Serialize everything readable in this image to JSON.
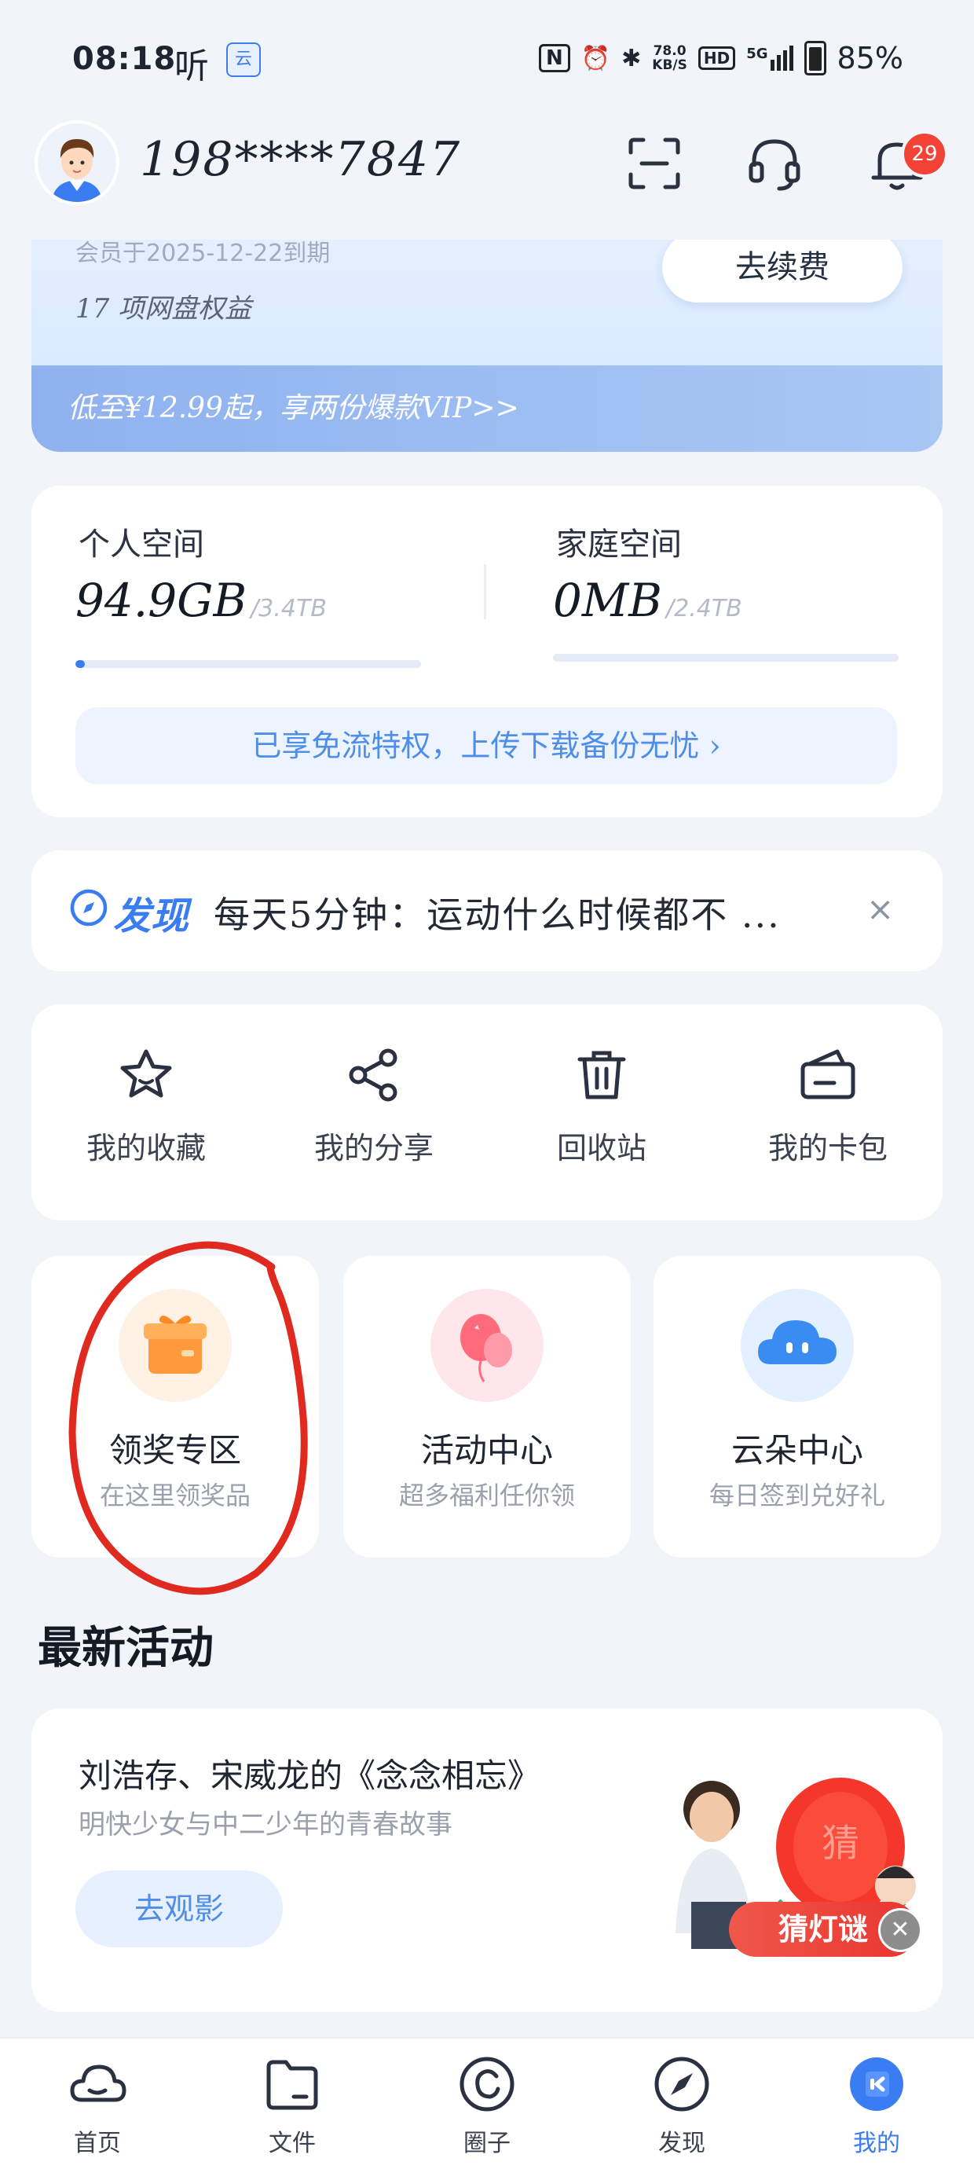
{
  "status_bar": {
    "time": "08:18",
    "ting": "听",
    "app_icon_text": "云",
    "nfc": "N",
    "net_speed_value": "78.0",
    "net_speed_unit": "KB/S",
    "hd": "HD",
    "network": "5G",
    "battery": "85%"
  },
  "header": {
    "phone": "198****7847",
    "notification_count": "29",
    "icons": [
      "scan-icon",
      "headset-icon",
      "bell-icon"
    ]
  },
  "vip_card": {
    "expire_text": "会员于2025-12-22到期",
    "rights_text": "17 项网盘权益",
    "renew_label": "去续费",
    "promo_text": "低至¥12.99起，享两份爆款VIP>>"
  },
  "storage": {
    "personal": {
      "title": "个人空间",
      "used": "94.9GB",
      "total": "/3.4TB",
      "fraction": 0.028
    },
    "family": {
      "title": "家庭空间",
      "used": "0MB",
      "total": "/2.4TB",
      "fraction": 0.0
    },
    "privilege_text": "已享免流特权，上传下载备份无忧"
  },
  "discover": {
    "label": "发现",
    "text": "每天5分钟：运动什么时候都不 ...",
    "close": "×"
  },
  "tools": [
    {
      "label": "我的收藏",
      "icon": "star-icon"
    },
    {
      "label": "我的分享",
      "icon": "share-icon"
    },
    {
      "label": "回收站",
      "icon": "trash-icon"
    },
    {
      "label": "我的卡包",
      "icon": "card-wallet-icon"
    }
  ],
  "tiles": [
    {
      "title": "领奖专区",
      "subtitle": "在这里领奖品",
      "icon": "gift-icon"
    },
    {
      "title": "活动中心",
      "subtitle": "超多福利任你领",
      "icon": "balloon-icon"
    },
    {
      "title": "云朵中心",
      "subtitle": "每日签到兑好礼",
      "icon": "cloud-icon"
    }
  ],
  "latest": {
    "section_title": "最新活动",
    "title": "刘浩存、宋威龙的《念念相忘》",
    "subtitle": "明快少女与中二少年的青春故事",
    "button": "去观影",
    "lantern_tag": "猜灯谜",
    "lantern_char": "猜"
  },
  "bottom_nav": [
    {
      "label": "首页",
      "icon": "home-cloud-icon"
    },
    {
      "label": "文件",
      "icon": "folder-icon"
    },
    {
      "label": "圈子",
      "icon": "circle-c-icon"
    },
    {
      "label": "发现",
      "icon": "compass-icon"
    },
    {
      "label": "我的",
      "icon": "profile-icon"
    }
  ],
  "colors": {
    "accent": "#3a7cf2",
    "badge": "#f44336",
    "annotation": "#e0291f"
  }
}
